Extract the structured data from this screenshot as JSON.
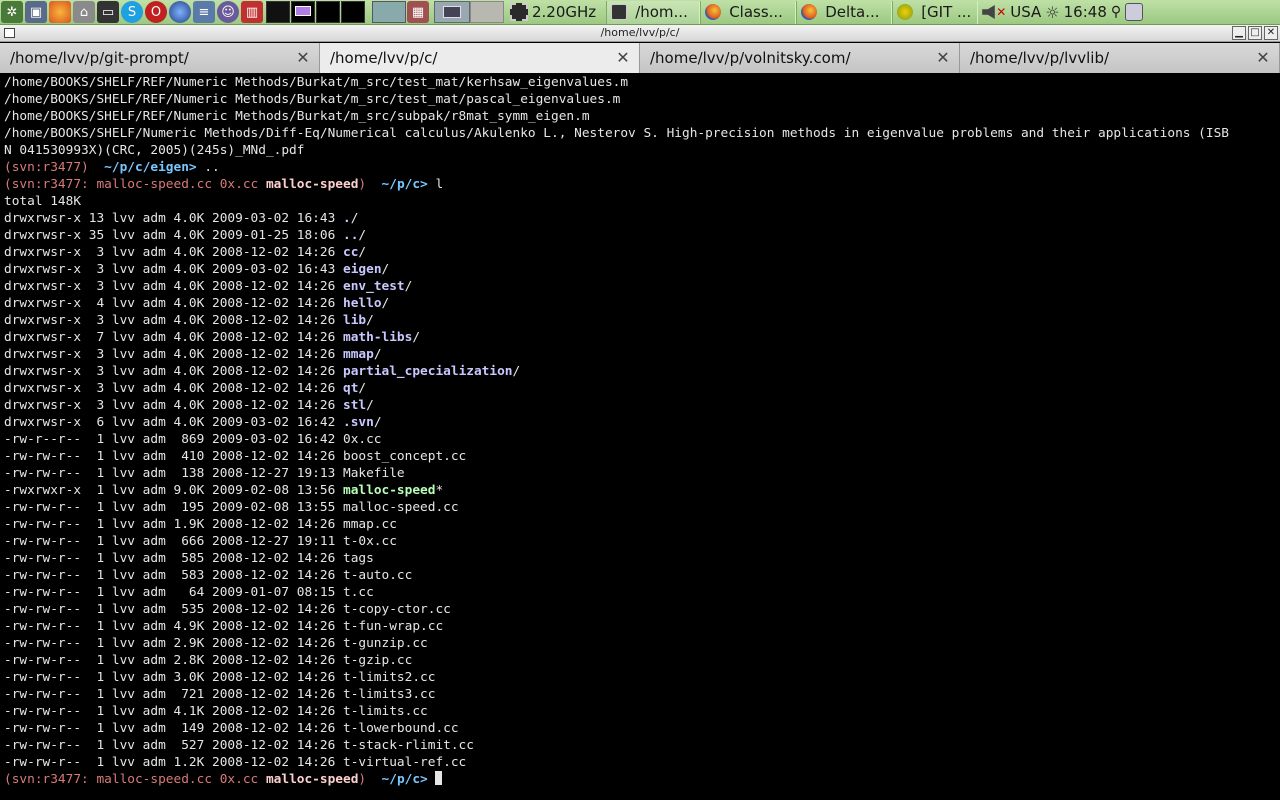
{
  "panel": {
    "cpu_freq": "2.20GHz",
    "tasks": [
      {
        "type": "term",
        "label": "/hom..."
      },
      {
        "type": "ff",
        "label": "Class..."
      },
      {
        "type": "ff",
        "label": "Delta..."
      },
      {
        "type": "git",
        "label": "[GIT ..."
      }
    ],
    "keyboard_layout": "USA",
    "clock": "16:48"
  },
  "window": {
    "title": "/home/lvv/p/c/"
  },
  "tabs": [
    {
      "label": "/home/lvv/p/git-prompt/",
      "active": false
    },
    {
      "label": "/home/lvv/p/c/",
      "active": true
    },
    {
      "label": "/home/lvv/p/volnitsky.com/",
      "active": false
    },
    {
      "label": "/home/lvv/p/lvvlib/",
      "active": false
    }
  ],
  "terminal": {
    "lines": [
      [
        {
          "t": "/home/BOOKS/SHELF/REF/Numeric Methods/Burkat/m_src/test_mat/kerhsaw_eigenvalues.m"
        }
      ],
      [
        {
          "t": "/home/BOOKS/SHELF/REF/Numeric Methods/Burkat/m_src/test_mat/pascal_eigenvalues.m"
        }
      ],
      [
        {
          "t": "/home/BOOKS/SHELF/REF/Numeric Methods/Burkat/m_src/subpak/r8mat_symm_eigen.m"
        }
      ],
      [
        {
          "t": "/home/BOOKS/SHELF/Numeric Methods/Diff-Eq/Numerical calculus/Akulenko L., Nesterov S. High-precision methods in eigenvalue problems and their applications (ISB"
        }
      ],
      [
        {
          "t": "N 041530993X)(CRC, 2005)(245s)_MNd_.pdf"
        }
      ],
      [
        {
          "t": "(svn:r3477)  ",
          "c": "svn"
        },
        {
          "t": "~/p/c/eigen> ",
          "c": "prompt-path"
        },
        {
          "t": ".."
        }
      ],
      [
        {
          "t": "(svn:r3477: malloc-speed.cc 0x.cc ",
          "c": "svn"
        },
        {
          "t": "malloc-speed",
          "c": "svn-bold"
        },
        {
          "t": ")  ",
          "c": "svn"
        },
        {
          "t": "~/p/c> ",
          "c": "prompt-path"
        },
        {
          "t": "l"
        }
      ],
      [
        {
          "t": "total 148K"
        }
      ],
      [
        {
          "t": "drwxrwsr-x 13 lvv adm 4.0K 2009-03-02 16:43 "
        },
        {
          "t": ".",
          "c": "dir"
        },
        {
          "t": "/"
        }
      ],
      [
        {
          "t": "drwxrwsr-x 35 lvv adm 4.0K 2009-01-25 18:06 "
        },
        {
          "t": "..",
          "c": "dir"
        },
        {
          "t": "/"
        }
      ],
      [
        {
          "t": "drwxrwsr-x  3 lvv adm 4.0K 2008-12-02 14:26 "
        },
        {
          "t": "cc",
          "c": "dir"
        },
        {
          "t": "/"
        }
      ],
      [
        {
          "t": "drwxrwsr-x  3 lvv adm 4.0K 2009-03-02 16:43 "
        },
        {
          "t": "eigen",
          "c": "dir"
        },
        {
          "t": "/"
        }
      ],
      [
        {
          "t": "drwxrwsr-x  3 lvv adm 4.0K 2008-12-02 14:26 "
        },
        {
          "t": "env_test",
          "c": "dir"
        },
        {
          "t": "/"
        }
      ],
      [
        {
          "t": "drwxrwsr-x  4 lvv adm 4.0K 2008-12-02 14:26 "
        },
        {
          "t": "hello",
          "c": "dir"
        },
        {
          "t": "/"
        }
      ],
      [
        {
          "t": "drwxrwsr-x  3 lvv adm 4.0K 2008-12-02 14:26 "
        },
        {
          "t": "lib",
          "c": "dir"
        },
        {
          "t": "/"
        }
      ],
      [
        {
          "t": "drwxrwsr-x  7 lvv adm 4.0K 2008-12-02 14:26 "
        },
        {
          "t": "math-libs",
          "c": "dir"
        },
        {
          "t": "/"
        }
      ],
      [
        {
          "t": "drwxrwsr-x  3 lvv adm 4.0K 2008-12-02 14:26 "
        },
        {
          "t": "mmap",
          "c": "dir"
        },
        {
          "t": "/"
        }
      ],
      [
        {
          "t": "drwxrwsr-x  3 lvv adm 4.0K 2008-12-02 14:26 "
        },
        {
          "t": "partial_cpecialization",
          "c": "dir"
        },
        {
          "t": "/"
        }
      ],
      [
        {
          "t": "drwxrwsr-x  3 lvv adm 4.0K 2008-12-02 14:26 "
        },
        {
          "t": "qt",
          "c": "dir"
        },
        {
          "t": "/"
        }
      ],
      [
        {
          "t": "drwxrwsr-x  3 lvv adm 4.0K 2008-12-02 14:26 "
        },
        {
          "t": "stl",
          "c": "dir"
        },
        {
          "t": "/"
        }
      ],
      [
        {
          "t": "drwxrwsr-x  6 lvv adm 4.0K 2009-03-02 16:42 "
        },
        {
          "t": ".svn",
          "c": "dir"
        },
        {
          "t": "/"
        }
      ],
      [
        {
          "t": "-rw-r--r--  1 lvv adm  869 2009-03-02 16:42 0x.cc"
        }
      ],
      [
        {
          "t": "-rw-rw-r--  1 lvv adm  410 2008-12-02 14:26 boost_concept.cc"
        }
      ],
      [
        {
          "t": "-rw-rw-r--  1 lvv adm  138 2008-12-27 19:13 Makefile"
        }
      ],
      [
        {
          "t": "-rwxrwxr-x  1 lvv adm 9.0K 2009-02-08 13:56 "
        },
        {
          "t": "malloc-speed",
          "c": "exe"
        },
        {
          "t": "*"
        }
      ],
      [
        {
          "t": "-rw-rw-r--  1 lvv adm  195 2009-02-08 13:55 malloc-speed.cc"
        }
      ],
      [
        {
          "t": "-rw-rw-r--  1 lvv adm 1.9K 2008-12-02 14:26 mmap.cc"
        }
      ],
      [
        {
          "t": "-rw-rw-r--  1 lvv adm  666 2008-12-27 19:11 t-0x.cc"
        }
      ],
      [
        {
          "t": "-rw-rw-r--  1 lvv adm  585 2008-12-02 14:26 tags"
        }
      ],
      [
        {
          "t": "-rw-rw-r--  1 lvv adm  583 2008-12-02 14:26 t-auto.cc"
        }
      ],
      [
        {
          "t": "-rw-rw-r--  1 lvv adm   64 2009-01-07 08:15 t.cc"
        }
      ],
      [
        {
          "t": "-rw-rw-r--  1 lvv adm  535 2008-12-02 14:26 t-copy-ctor.cc"
        }
      ],
      [
        {
          "t": "-rw-rw-r--  1 lvv adm 4.9K 2008-12-02 14:26 t-fun-wrap.cc"
        }
      ],
      [
        {
          "t": "-rw-rw-r--  1 lvv adm 2.9K 2008-12-02 14:26 t-gunzip.cc"
        }
      ],
      [
        {
          "t": "-rw-rw-r--  1 lvv adm 2.8K 2008-12-02 14:26 t-gzip.cc"
        }
      ],
      [
        {
          "t": "-rw-rw-r--  1 lvv adm 3.0K 2008-12-02 14:26 t-limits2.cc"
        }
      ],
      [
        {
          "t": "-rw-rw-r--  1 lvv adm  721 2008-12-02 14:26 t-limits3.cc"
        }
      ],
      [
        {
          "t": "-rw-rw-r--  1 lvv adm 4.1K 2008-12-02 14:26 t-limits.cc"
        }
      ],
      [
        {
          "t": "-rw-rw-r--  1 lvv adm  149 2008-12-02 14:26 t-lowerbound.cc"
        }
      ],
      [
        {
          "t": "-rw-rw-r--  1 lvv adm  527 2008-12-02 14:26 t-stack-rlimit.cc"
        }
      ],
      [
        {
          "t": "-rw-rw-r--  1 lvv adm 1.2K 2008-12-02 14:26 t-virtual-ref.cc"
        }
      ],
      [
        {
          "t": "(svn:r3477: malloc-speed.cc 0x.cc ",
          "c": "svn"
        },
        {
          "t": "malloc-speed",
          "c": "svn-bold"
        },
        {
          "t": ")  ",
          "c": "svn"
        },
        {
          "t": "~/p/c> ",
          "c": "prompt-path"
        },
        {
          "t": "",
          "cursor": true
        }
      ]
    ]
  }
}
